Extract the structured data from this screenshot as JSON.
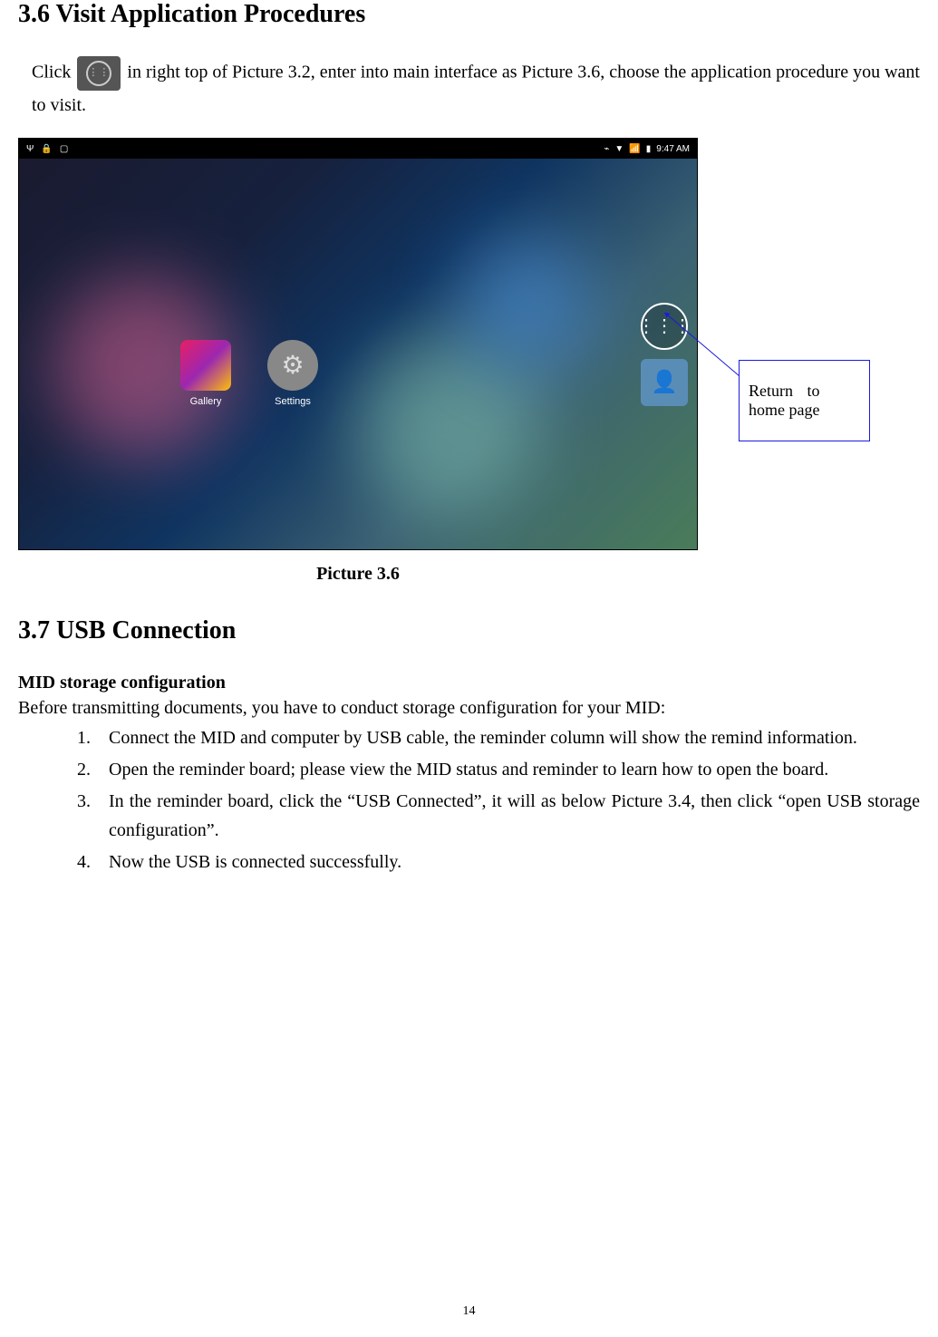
{
  "section_3_6": {
    "heading": "3.6 Visit Application Procedures",
    "para_part1": "Click ",
    "para_part2": "in right top of Picture 3.2, enter into main interface as Picture 3.6, choose the application procedure you want to visit.",
    "caption": "Picture 3.6"
  },
  "screenshot": {
    "status_time": "9:47 AM",
    "status_bluetooth": "⌁",
    "apps": {
      "gallery": "Gallery",
      "settings": "Settings"
    }
  },
  "callout": {
    "line1_left": "Return",
    "line1_right": "to",
    "line2": "home page"
  },
  "section_3_7": {
    "heading": "3.7 USB Connection",
    "subheading": "MID storage configuration",
    "intro": "Before transmitting documents, you have to conduct storage configuration for your MID:",
    "steps": [
      "Connect the MID and computer by USB cable, the reminder column will show the remind information.",
      "Open the reminder board; please view the MID status and reminder to learn how to open the board.",
      "In the reminder board, click the “USB Connected”, it will as below Picture 3.4, then click “open USB storage configuration”.",
      "Now the USB is connected successfully."
    ]
  },
  "page_number": "14"
}
